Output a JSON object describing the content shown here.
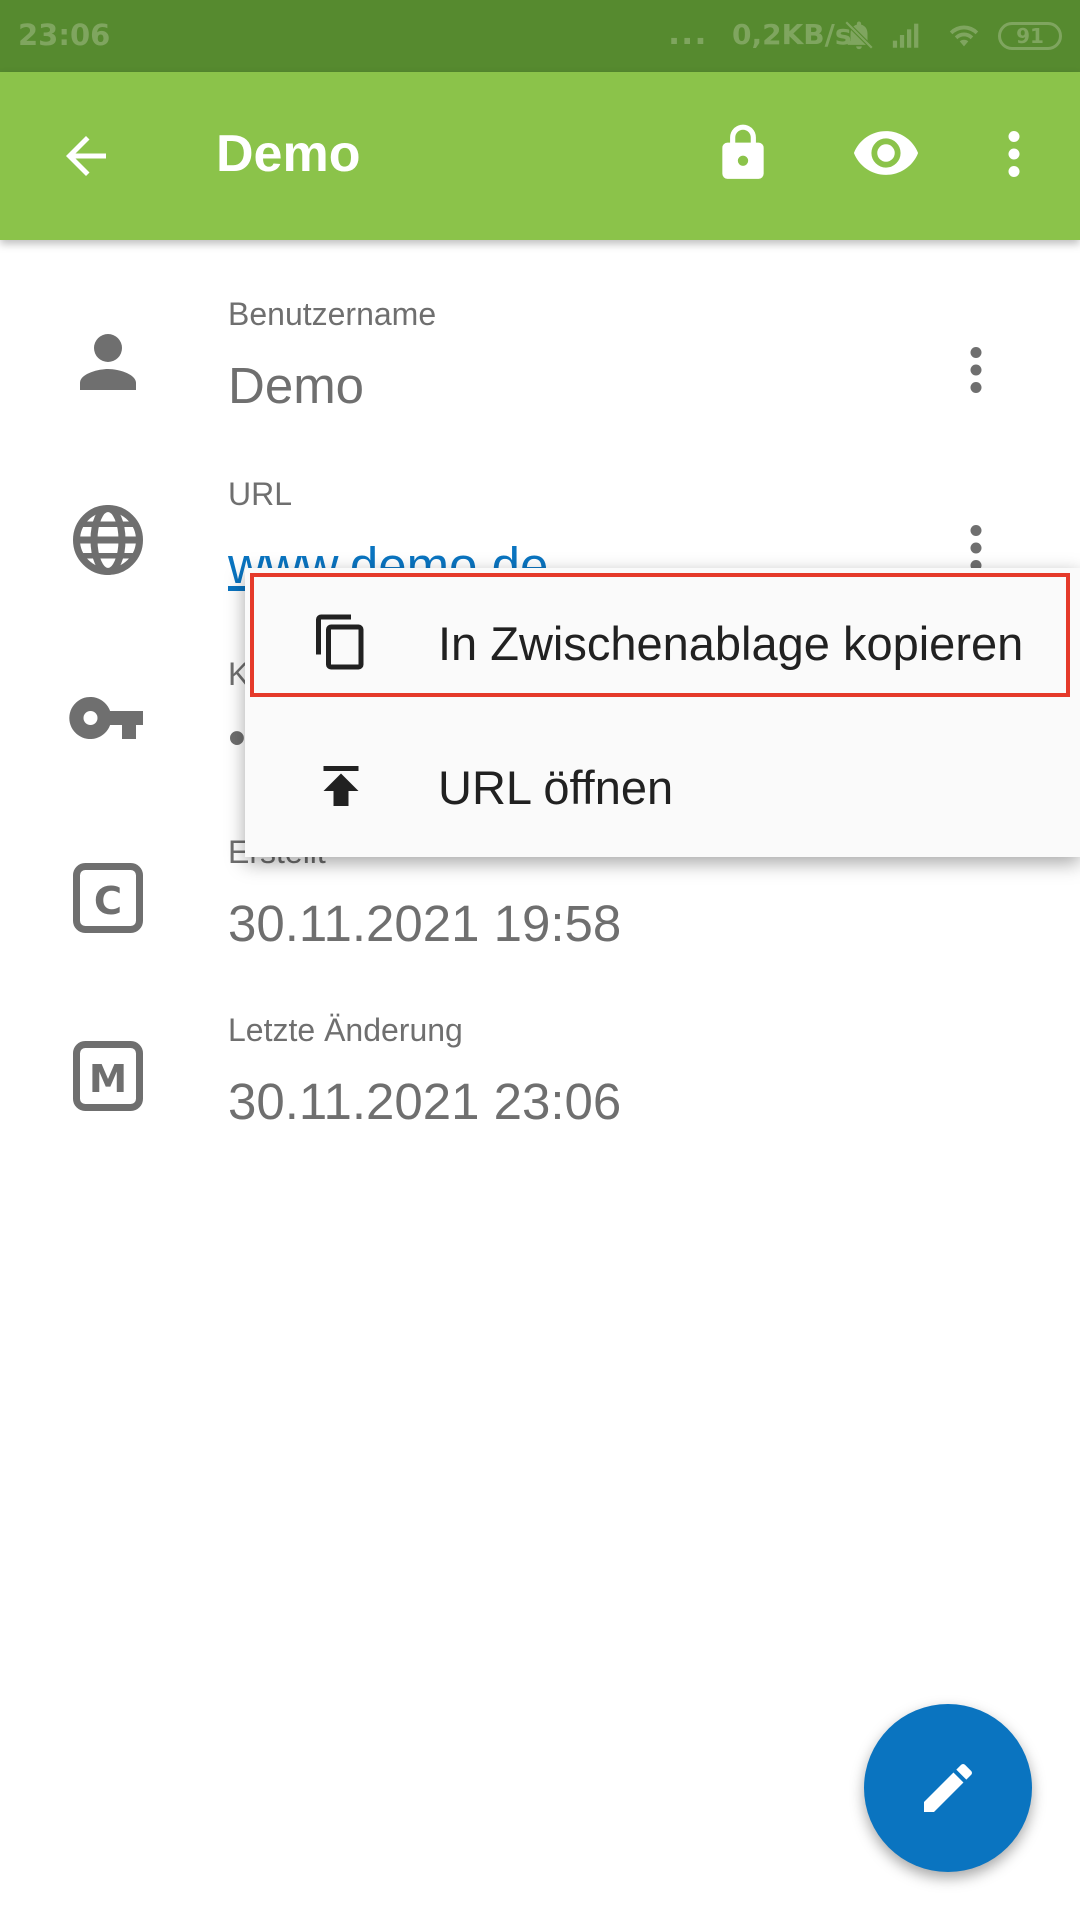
{
  "status_bar": {
    "time": "23:06",
    "dots": "...",
    "network_speed": "0,2KB/s",
    "battery": "91",
    "icons": [
      "notifications-off-icon",
      "signal-icon",
      "wifi-icon",
      "battery-icon"
    ]
  },
  "app_bar": {
    "title": "Demo",
    "icons": [
      "back-arrow-icon",
      "lock-icon",
      "eye-icon",
      "more-vert-icon"
    ],
    "color": "#8bc34a"
  },
  "fields": [
    {
      "label": "Benutzername",
      "value": "Demo",
      "icon": "person-icon"
    },
    {
      "label": "URL",
      "value": "www.demo.de",
      "icon": "globe-icon"
    },
    {
      "label": "K",
      "value": "•",
      "icon": "key-icon"
    },
    {
      "label": "Erstellt",
      "value": "30.11.2021 19:58",
      "icon": "created-c-icon"
    },
    {
      "label": "Letzte Änderung",
      "value": "30.11.2021 23:06",
      "icon": "modified-m-icon"
    }
  ],
  "context_menu": {
    "items": [
      {
        "label": "In Zwischenablage kopieren",
        "icon": "copy-icon",
        "highlighted": true
      },
      {
        "label": "URL öffnen",
        "icon": "upload-open-icon",
        "highlighted": false
      }
    ]
  },
  "icon_letters": {
    "created": "C",
    "modified": "M"
  },
  "fab": {
    "icon": "edit-pencil-icon",
    "color": "#0a74c0"
  },
  "colors": {
    "statusbar": "#568a2f",
    "link": "#0a74c0",
    "highlight": "#e53a2a"
  }
}
